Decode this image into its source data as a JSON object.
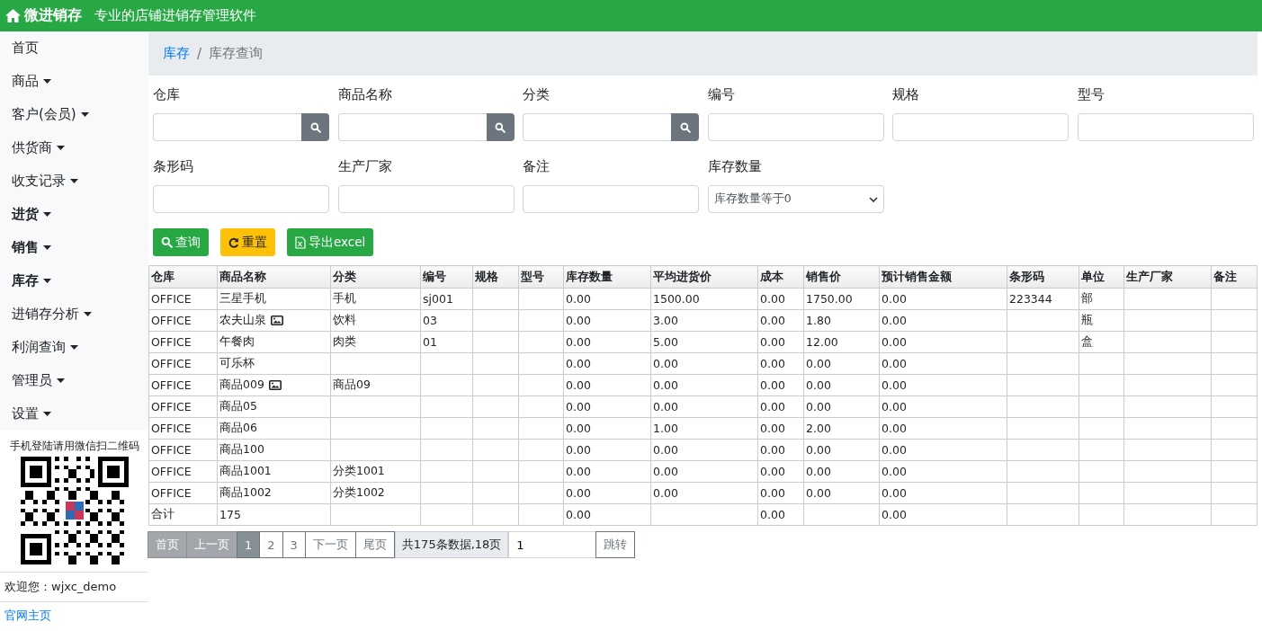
{
  "header": {
    "brand": "微进销存",
    "tagline": "专业的店铺进销存管理软件"
  },
  "sidebar": {
    "items": [
      {
        "label": "首页",
        "dropdown": false,
        "bold": false
      },
      {
        "label": "商品",
        "dropdown": true,
        "bold": false
      },
      {
        "label": "客户(会员)",
        "dropdown": true,
        "bold": false
      },
      {
        "label": "供货商",
        "dropdown": true,
        "bold": false
      },
      {
        "label": "收支记录",
        "dropdown": true,
        "bold": false
      },
      {
        "label": "进货",
        "dropdown": true,
        "bold": true
      },
      {
        "label": "销售",
        "dropdown": true,
        "bold": true
      },
      {
        "label": "库存",
        "dropdown": true,
        "bold": true
      },
      {
        "label": "进销存分析",
        "dropdown": true,
        "bold": false
      },
      {
        "label": "利润查询",
        "dropdown": true,
        "bold": false
      },
      {
        "label": "管理员",
        "dropdown": true,
        "bold": false
      },
      {
        "label": "设置",
        "dropdown": true,
        "bold": false
      }
    ],
    "qr_caption": "手机登陆请用微信扫二维码",
    "welcome": "欢迎您：wjxc_demo",
    "home_link": "官网主页"
  },
  "breadcrumb": {
    "separator": "/",
    "items": [
      {
        "label": "库存",
        "link": true
      },
      {
        "label": "库存查询",
        "link": false
      }
    ]
  },
  "filters": [
    {
      "label": "仓库",
      "kind": "search"
    },
    {
      "label": "商品名称",
      "kind": "search"
    },
    {
      "label": "分类",
      "kind": "search"
    },
    {
      "label": "编号",
      "kind": "text"
    },
    {
      "label": "规格",
      "kind": "text"
    },
    {
      "label": "型号",
      "kind": "text"
    },
    {
      "label": "条形码",
      "kind": "text"
    },
    {
      "label": "生产厂家",
      "kind": "text"
    },
    {
      "label": "备注",
      "kind": "text"
    },
    {
      "label": "库存数量",
      "kind": "select",
      "value": "库存数量等于0"
    }
  ],
  "actions": [
    {
      "label": "查询",
      "kind": "search"
    },
    {
      "label": "重置",
      "kind": "reset"
    },
    {
      "label": "导出excel",
      "kind": "export"
    }
  ],
  "table": {
    "columns": [
      "仓库",
      "商品名称",
      "分类",
      "编号",
      "规格",
      "型号",
      "库存数量",
      "平均进货价",
      "成本",
      "销售价",
      "预计销售金额",
      "条形码",
      "单位",
      "生产厂家",
      "备注"
    ],
    "rows": [
      {
        "cells": [
          "OFFICE",
          "三星手机",
          "手机",
          "sj001",
          null,
          null,
          "0.00",
          "1500.00",
          "0.00",
          "1750.00",
          "0.00",
          "223344",
          "部",
          null,
          null
        ],
        "has_image": false
      },
      {
        "cells": [
          "OFFICE",
          "农夫山泉",
          "饮料",
          "03",
          null,
          null,
          "0.00",
          "3.00",
          "0.00",
          "1.80",
          "0.00",
          null,
          "瓶",
          null,
          null
        ],
        "has_image": true
      },
      {
        "cells": [
          "OFFICE",
          "午餐肉",
          "肉类",
          "01",
          null,
          null,
          "0.00",
          "5.00",
          "0.00",
          "12.00",
          "0.00",
          null,
          "盒",
          null,
          null
        ],
        "has_image": false
      },
      {
        "cells": [
          "OFFICE",
          "可乐杯",
          null,
          null,
          null,
          null,
          "0.00",
          "0.00",
          "0.00",
          "0.00",
          "0.00",
          null,
          null,
          null,
          null
        ],
        "has_image": false
      },
      {
        "cells": [
          "OFFICE",
          "商品009",
          "商品09",
          null,
          null,
          null,
          "0.00",
          "0.00",
          "0.00",
          "0.00",
          "0.00",
          null,
          null,
          null,
          null
        ],
        "has_image": true
      },
      {
        "cells": [
          "OFFICE",
          "商品05",
          null,
          null,
          null,
          null,
          "0.00",
          "0.00",
          "0.00",
          "0.00",
          "0.00",
          null,
          null,
          null,
          null
        ],
        "has_image": false
      },
      {
        "cells": [
          "OFFICE",
          "商品06",
          null,
          null,
          null,
          null,
          "0.00",
          "1.00",
          "0.00",
          "2.00",
          "0.00",
          null,
          null,
          null,
          null
        ],
        "has_image": false
      },
      {
        "cells": [
          "OFFICE",
          "商品100",
          null,
          null,
          null,
          null,
          "0.00",
          "0.00",
          "0.00",
          "0.00",
          "0.00",
          null,
          null,
          null,
          null
        ],
        "has_image": false
      },
      {
        "cells": [
          "OFFICE",
          "商品1001",
          "分类1001",
          null,
          null,
          null,
          "0.00",
          "0.00",
          "0.00",
          "0.00",
          "0.00",
          null,
          null,
          null,
          null
        ],
        "has_image": false
      },
      {
        "cells": [
          "OFFICE",
          "商品1002",
          "分类1002",
          null,
          null,
          null,
          "0.00",
          "0.00",
          "0.00",
          "0.00",
          "0.00",
          null,
          null,
          null,
          null
        ],
        "has_image": false
      },
      {
        "cells": [
          "合计",
          "175",
          null,
          null,
          null,
          null,
          "0.00",
          null,
          "0.00",
          null,
          "0.00",
          null,
          null,
          null,
          null
        ],
        "has_image": false
      }
    ]
  },
  "pagination": {
    "pages": [
      {
        "label": "首页",
        "disabled": true,
        "selected": false
      },
      {
        "label": "上一页",
        "disabled": true,
        "selected": false
      },
      {
        "label": "1",
        "disabled": false,
        "selected": true
      },
      {
        "label": "2",
        "disabled": false,
        "selected": false
      },
      {
        "label": "3",
        "disabled": false,
        "selected": false
      },
      {
        "label": "下一页",
        "disabled": false,
        "selected": false
      },
      {
        "label": "尾页",
        "disabled": false,
        "selected": false
      }
    ],
    "summary": "共175条数据,18页",
    "jump_value": "1",
    "jump_button": "跳转"
  }
}
